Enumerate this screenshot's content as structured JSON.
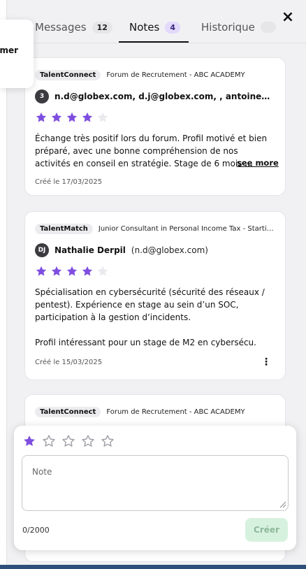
{
  "popover": {
    "label": "Fermer"
  },
  "tabs": [
    {
      "label": "Messages",
      "count": "12",
      "active": false
    },
    {
      "label": "Notes",
      "count": "4",
      "active": true
    },
    {
      "label": "Historique",
      "count": "",
      "active": false
    }
  ],
  "close_label": "×",
  "colors": {
    "star_filled": "#7e4ee0",
    "star_empty": "#e9e9ee",
    "star_outline": "#9a9aa2",
    "accent_badge": "#e3d9fb",
    "create_bg": "#d6f2df"
  },
  "notes": [
    {
      "source": "TalentConnect",
      "event": "Forum de Recrutement - ABC ACADEMY",
      "avatar": "3",
      "name": "n.d@globex.com, d.j@globex.com, , antoine@globex.com",
      "email": "",
      "rating": 4,
      "max_rating": 5,
      "text": "Échange très positif lors du forum. Profil motivé et bien préparé, avec une bonne compréhension de nos activités en conseil en stratégie. Stage de 6 mois ...",
      "see_more": "see more",
      "created": "Créé le 17/03/2025"
    },
    {
      "source": "TalentMatch",
      "event": "Junior Consultant in Personal Income Tax - Starting",
      "avatar": "DJ",
      "name": "Nathalie Derpil",
      "email": "(n.d@globex.com)",
      "rating": 4,
      "max_rating": 5,
      "text": "Spécialisation en cybersécurité (sécurité des réseaux / pentest). Expérience en stage au sein d’un SOC, participation à la gestion d’incidents.",
      "text2": "Profil intéressant pour un stage de M2 en cybersécu.",
      "created": "Créé le 15/03/2025",
      "more_icon": "⋮"
    },
    {
      "source": "TalentConnect",
      "event": "Forum de Recrutement - ABC ACADEMY"
    }
  ],
  "composer": {
    "rating": 1,
    "max_rating": 5,
    "placeholder": "Note",
    "counter": "0/2000",
    "create_label": "Créer"
  }
}
